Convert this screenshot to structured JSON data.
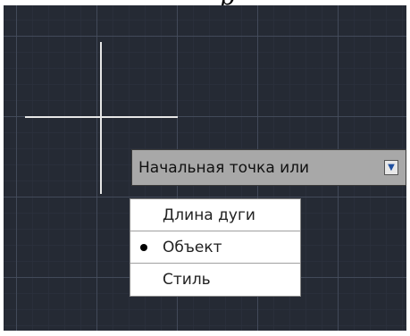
{
  "caption": "р",
  "prompt": {
    "text": "Начальная точка или",
    "arrow_icon": "down-arrow-icon"
  },
  "menu": {
    "items": [
      {
        "label": "Длина дуги",
        "selected": false
      },
      {
        "label": "Объект",
        "selected": true
      },
      {
        "label": "Стиль",
        "selected": false
      }
    ]
  },
  "colors": {
    "canvas_background": "#252a34",
    "crosshair": "#e6e6e6",
    "prompt_background": "#a8a8a8",
    "menu_background": "#ffffff"
  }
}
